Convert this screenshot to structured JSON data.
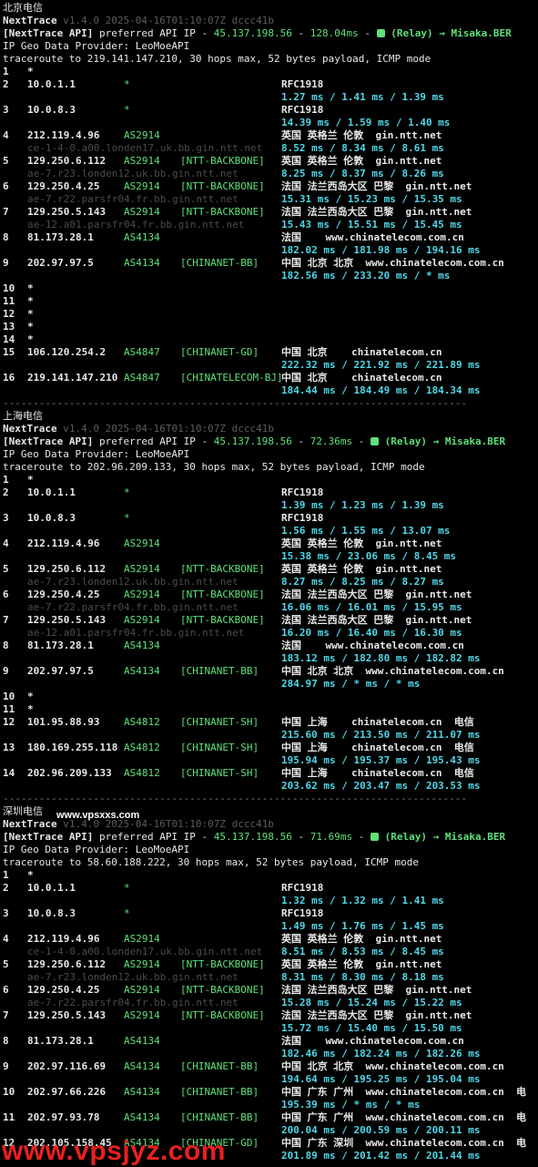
{
  "sections": [
    {
      "title": "北京电信",
      "app": "NextTrace",
      "version": "v1.4.0 2025-04-16T01:10:07Z dccc41b",
      "api_label": "[NextTrace API]",
      "api_text": " preferred API IP - ",
      "api_ip": "45.137.198.56",
      "api_dash": " - ",
      "api_latency": "128.04ms",
      "relay": " (Relay) → Misaka.BER",
      "geo_provider": "IP Geo Data Provider: LeoMoeAPI",
      "traceroute": "traceroute to 219.141.147.210, 30 hops max, 52 bytes payload, ICMP mode",
      "hops": [
        {
          "n": "1",
          "ip": "*",
          "asn": "",
          "tag": "",
          "geo": "",
          "rtt": "",
          "host": ""
        },
        {
          "n": "2",
          "ip": "10.0.1.1",
          "asn": "*",
          "tag": "",
          "geo": "RFC1918",
          "rtt": "1.27 ms / 1.41 ms / 1.39 ms",
          "host": ""
        },
        {
          "n": "3",
          "ip": "10.0.8.3",
          "asn": "*",
          "tag": "",
          "geo": "RFC1918",
          "rtt": "14.39 ms / 1.59 ms / 1.40 ms",
          "host": ""
        },
        {
          "n": "4",
          "ip": "212.119.4.96",
          "asn": "AS2914",
          "tag": "",
          "geo": "英国 英格兰 伦敦  gin.ntt.net",
          "rtt": "8.52 ms / 8.34 ms / 8.61 ms",
          "host": "ce-1-4-0.a00.londen17.uk.bb.gin.ntt.net"
        },
        {
          "n": "5",
          "ip": "129.250.6.112",
          "asn": "AS2914",
          "tag": "[NTT-BACKBONE]",
          "geo": "英国 英格兰 伦敦  gin.ntt.net",
          "rtt": "8.25 ms / 8.37 ms / 8.26 ms",
          "host": "ae-7.r23.londen12.uk.bb.gin.ntt.net"
        },
        {
          "n": "6",
          "ip": "129.250.4.25",
          "asn": "AS2914",
          "tag": "[NTT-BACKBONE]",
          "geo": "法国 法兰西岛大区 巴黎  gin.ntt.net",
          "rtt": "15.31 ms / 15.23 ms / 15.35 ms",
          "host": "ae-7.r22.parsfr04.fr.bb.gin.ntt.net"
        },
        {
          "n": "7",
          "ip": "129.250.5.143",
          "asn": "AS2914",
          "tag": "[NTT-BACKBONE]",
          "geo": "法国 法兰西岛大区 巴黎  gin.ntt.net",
          "rtt": "15.43 ms / 15.51 ms / 15.45 ms",
          "host": "ae-12.a01.parsfr04.fr.bb.gin.ntt.net"
        },
        {
          "n": "8",
          "ip": "81.173.28.1",
          "asn": "AS4134",
          "tag": "",
          "geo": "法国    www.chinatelecom.com.cn",
          "rtt": "182.02 ms / 181.98 ms / 194.16 ms",
          "host": ""
        },
        {
          "n": "9",
          "ip": "202.97.97.5",
          "asn": "AS4134",
          "tag": "[CHINANET-BB]",
          "geo": "中国 北京 北京  www.chinatelecom.com.cn",
          "rtt": "182.56 ms / 233.20 ms / * ms",
          "host": ""
        },
        {
          "n": "10",
          "ip": "*",
          "asn": "",
          "tag": "",
          "geo": "",
          "rtt": "",
          "host": ""
        },
        {
          "n": "11",
          "ip": "*",
          "asn": "",
          "tag": "",
          "geo": "",
          "rtt": "",
          "host": ""
        },
        {
          "n": "12",
          "ip": "*",
          "asn": "",
          "tag": "",
          "geo": "",
          "rtt": "",
          "host": ""
        },
        {
          "n": "13",
          "ip": "*",
          "asn": "",
          "tag": "",
          "geo": "",
          "rtt": "",
          "host": ""
        },
        {
          "n": "14",
          "ip": "*",
          "asn": "",
          "tag": "",
          "geo": "",
          "rtt": "",
          "host": ""
        },
        {
          "n": "15",
          "ip": "106.120.254.2",
          "asn": "AS4847",
          "tag": "[CHINANET-GD]",
          "geo": "中国 北京    chinatelecom.cn",
          "rtt": "222.32 ms / 221.92 ms / 221.89 ms",
          "host": ""
        },
        {
          "n": "16",
          "ip": "219.141.147.210",
          "asn": "AS4847",
          "tag": "[CHINATELECOM-BJ]",
          "geo": "中国 北京    chinatelecom.cn",
          "rtt": "184.44 ms / 184.49 ms / 184.34 ms",
          "host": ""
        }
      ],
      "separator": "-----------------------------------------------------------------------------"
    },
    {
      "title": "上海电信",
      "app": "NextTrace",
      "version": "v1.4.0 2025-04-16T01:10:07Z dccc41b",
      "api_label": "[NextTrace API]",
      "api_text": " preferred API IP - ",
      "api_ip": "45.137.198.56",
      "api_dash": " - ",
      "api_latency": "72.36ms",
      "relay": " (Relay) → Misaka.BER",
      "geo_provider": "IP Geo Data Provider: LeoMoeAPI",
      "traceroute": "traceroute to 202.96.209.133, 30 hops max, 52 bytes payload, ICMP mode",
      "hops": [
        {
          "n": "1",
          "ip": "*",
          "asn": "",
          "tag": "",
          "geo": "",
          "rtt": "",
          "host": ""
        },
        {
          "n": "2",
          "ip": "10.0.1.1",
          "asn": "*",
          "tag": "",
          "geo": "RFC1918",
          "rtt": "1.39 ms / 1.23 ms / 1.39 ms",
          "host": ""
        },
        {
          "n": "3",
          "ip": "10.0.8.3",
          "asn": "*",
          "tag": "",
          "geo": "RFC1918",
          "rtt": "1.56 ms / 1.55 ms / 13.07 ms",
          "host": ""
        },
        {
          "n": "4",
          "ip": "212.119.4.96",
          "asn": "AS2914",
          "tag": "",
          "geo": "英国 英格兰 伦敦  gin.ntt.net",
          "rtt": "15.38 ms / 23.06 ms / 8.45 ms",
          "host": ""
        },
        {
          "n": "5",
          "ip": "129.250.6.112",
          "asn": "AS2914",
          "tag": "[NTT-BACKBONE]",
          "geo": "英国 英格兰 伦敦  gin.ntt.net",
          "rtt": "8.27 ms / 8.25 ms / 8.27 ms",
          "host": "ae-7.r23.londen12.uk.bb.gin.ntt.net"
        },
        {
          "n": "6",
          "ip": "129.250.4.25",
          "asn": "AS2914",
          "tag": "[NTT-BACKBONE]",
          "geo": "法国 法兰西岛大区 巴黎  gin.ntt.net",
          "rtt": "16.06 ms / 16.01 ms / 15.95 ms",
          "host": "ae-7.r22.parsfr04.fr.bb.gin.ntt.net"
        },
        {
          "n": "7",
          "ip": "129.250.5.143",
          "asn": "AS2914",
          "tag": "[NTT-BACKBONE]",
          "geo": "法国 法兰西岛大区 巴黎  gin.ntt.net",
          "rtt": "16.20 ms / 16.40 ms / 16.30 ms",
          "host": "ae-12.a01.parsfr04.fr.bb.gin.ntt.net"
        },
        {
          "n": "8",
          "ip": "81.173.28.1",
          "asn": "AS4134",
          "tag": "",
          "geo": "法国    www.chinatelecom.com.cn",
          "rtt": "183.12 ms / 182.80 ms / 182.82 ms",
          "host": ""
        },
        {
          "n": "9",
          "ip": "202.97.97.5",
          "asn": "AS4134",
          "tag": "[CHINANET-BB]",
          "geo": "中国 北京 北京  www.chinatelecom.com.cn",
          "rtt": "284.97 ms / * ms / * ms",
          "host": ""
        },
        {
          "n": "10",
          "ip": "*",
          "asn": "",
          "tag": "",
          "geo": "",
          "rtt": "",
          "host": ""
        },
        {
          "n": "11",
          "ip": "*",
          "asn": "",
          "tag": "",
          "geo": "",
          "rtt": "",
          "host": ""
        },
        {
          "n": "12",
          "ip": "101.95.88.93",
          "asn": "AS4812",
          "tag": "[CHINANET-SH]",
          "geo": "中国 上海    chinatelecom.cn  电信",
          "rtt": "215.60 ms / 213.50 ms / 211.07 ms",
          "host": ""
        },
        {
          "n": "13",
          "ip": "180.169.255.118",
          "asn": "AS4812",
          "tag": "[CHINANET-SH]",
          "geo": "中国 上海    chinatelecom.cn  电信",
          "rtt": "195.94 ms / 195.37 ms / 195.43 ms",
          "host": ""
        },
        {
          "n": "14",
          "ip": "202.96.209.133",
          "asn": "AS4812",
          "tag": "[CHINANET-SH]",
          "geo": "中国 上海    chinatelecom.cn  电信",
          "rtt": "203.62 ms / 203.47 ms / 203.53 ms",
          "host": ""
        }
      ],
      "separator": "-----------------------------------------------------------------------------"
    },
    {
      "title": "深圳电信",
      "app": "NextTrace",
      "version": "v1.4.0 2025-04-16T01:10:07Z dccc41b",
      "api_label": "[NextTrace API]",
      "api_text": " preferred API IP - ",
      "api_ip": "45.137.198.56",
      "api_dash": " - ",
      "api_latency": "71.69ms",
      "relay": " (Relay) → Misaka.BER",
      "geo_provider": "IP Geo Data Provider: LeoMoeAPI",
      "traceroute": "traceroute to 58.60.188.222, 30 hops max, 52 bytes payload, ICMP mode",
      "hops": [
        {
          "n": "1",
          "ip": "*",
          "asn": "",
          "tag": "",
          "geo": "",
          "rtt": "",
          "host": ""
        },
        {
          "n": "2",
          "ip": "10.0.1.1",
          "asn": "*",
          "tag": "",
          "geo": "RFC1918",
          "rtt": "1.32 ms / 1.32 ms / 1.41 ms",
          "host": ""
        },
        {
          "n": "3",
          "ip": "10.0.8.3",
          "asn": "*",
          "tag": "",
          "geo": "RFC1918",
          "rtt": "1.49 ms / 1.76 ms / 1.45 ms",
          "host": ""
        },
        {
          "n": "4",
          "ip": "212.119.4.96",
          "asn": "AS2914",
          "tag": "",
          "geo": "英国 英格兰 伦敦  gin.ntt.net",
          "rtt": "8.51 ms / 8.53 ms / 8.45 ms",
          "host": "ce-1-4-0.a00.londen17.uk.bb.gin.ntt.net"
        },
        {
          "n": "5",
          "ip": "129.250.6.112",
          "asn": "AS2914",
          "tag": "[NTT-BACKBONE]",
          "geo": "英国 英格兰 伦敦  gin.ntt.net",
          "rtt": "8.31 ms / 8.30 ms / 8.18 ms",
          "host": "ae-7.r23.londen12.uk.bb.gin.ntt.net"
        },
        {
          "n": "6",
          "ip": "129.250.4.25",
          "asn": "AS2914",
          "tag": "[NTT-BACKBONE]",
          "geo": "法国 法兰西岛大区 巴黎  gin.ntt.net",
          "rtt": "15.28 ms / 15.24 ms / 15.22 ms",
          "host": "ae-7.r22.parsfr04.fr.bb.gin.ntt.net"
        },
        {
          "n": "7",
          "ip": "129.250.5.143",
          "asn": "AS2914",
          "tag": "[NTT-BACKBONE]",
          "geo": "法国 法兰西岛大区 巴黎  gin.ntt.net",
          "rtt": "15.72 ms / 15.40 ms / 15.50 ms",
          "host": ""
        },
        {
          "n": "8",
          "ip": "81.173.28.1",
          "asn": "AS4134",
          "tag": "",
          "geo": "法国    www.chinatelecom.com.cn",
          "rtt": "182.46 ms / 182.24 ms / 182.26 ms",
          "host": ""
        },
        {
          "n": "9",
          "ip": "202.97.116.69",
          "asn": "AS4134",
          "tag": "[CHINANET-BB]",
          "geo": "中国 北京 北京  www.chinatelecom.com.cn",
          "rtt": "194.64 ms / 195.25 ms / 195.04 ms",
          "host": ""
        },
        {
          "n": "10",
          "ip": "202.97.66.226",
          "asn": "AS4134",
          "tag": "[CHINANET-BB]",
          "geo": "中国 广东 广州  www.chinatelecom.com.cn  电",
          "rtt": "195.39 ms / * ms / * ms",
          "host": ""
        },
        {
          "n": "11",
          "ip": "202.97.93.78",
          "asn": "AS4134",
          "tag": "[CHINANET-BB]",
          "geo": "中国 广东 广州  www.chinatelecom.com.cn  电",
          "rtt": "200.04 ms / 200.59 ms / 200.11 ms",
          "host": ""
        },
        {
          "n": "12",
          "ip": "202.105.158.45",
          "asn": "AS4134",
          "tag": "[CHINANET-GD]",
          "geo": "中国 广东 深圳  www.chinatelecom.com.cn  电",
          "rtt": "201.89 ms / 201.42 ms / 201.44 ms",
          "host": ""
        }
      ],
      "separator": ""
    }
  ],
  "watermark_top": "www.vpsxxs.com",
  "watermark_bottom": "www.vpsjyz.com",
  "colors": {
    "background": "#000000",
    "cyan": "#4fd8e8",
    "green": "#5fe07a",
    "grey": "#4b4b4b",
    "watermark": "#e8201e"
  }
}
